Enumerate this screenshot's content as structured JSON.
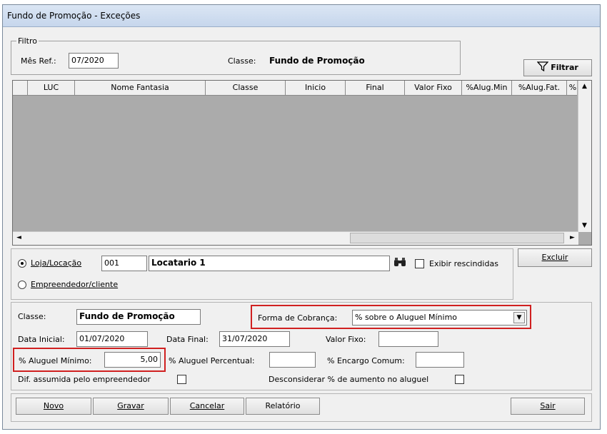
{
  "window": {
    "title": "Fundo de Promoção - Exceções"
  },
  "filtro": {
    "legend": "Filtro",
    "mes_ref_label": "Mês Ref.:",
    "mes_ref_value": "07/2020",
    "classe_label": "Classe:",
    "classe_value": "Fundo de Promoção",
    "filtrar_label": "Filtrar"
  },
  "grid": {
    "columns": [
      "LUC",
      "Nome Fantasia",
      "Classe",
      "Inicio",
      "Final",
      "Valor Fixo",
      "%Alug.Min",
      "%Alug.Fat.",
      "%"
    ]
  },
  "selection": {
    "loja_label": "Loja/Locação",
    "loja_code": "001",
    "loja_name": "Locatario 1",
    "exibir_label": "Exibir rescindidas",
    "empreendedor_label": "Empreendedor/cliente",
    "excluir_label": "Excluir"
  },
  "detail": {
    "classe_label": "Classe:",
    "classe_value": "Fundo de Promoção",
    "forma_label": "Forma de Cobrança:",
    "forma_value": "% sobre o Aluguel Mínimo",
    "data_inicial_label": "Data Inicial:",
    "data_inicial_value": "01/07/2020",
    "data_final_label": "Data Final:",
    "data_final_value": "31/07/2020",
    "valor_fixo_label": "Valor Fixo:",
    "valor_fixo_value": "",
    "aluguel_minimo_label": "% Aluguel Mínimo:",
    "aluguel_minimo_value": "5,00",
    "aluguel_percentual_label": "% Aluguel Percentual:",
    "aluguel_percentual_value": "",
    "encargo_label": "% Encargo Comum:",
    "encargo_value": "",
    "dif_label": "Dif. assumida pelo empreendedor",
    "desconsiderar_label": "Desconsiderar % de aumento no aluguel"
  },
  "buttons": {
    "novo": "Novo",
    "gravar": "Gravar",
    "cancelar": "Cancelar",
    "relatorio": "Relatório",
    "sair": "Sair"
  }
}
